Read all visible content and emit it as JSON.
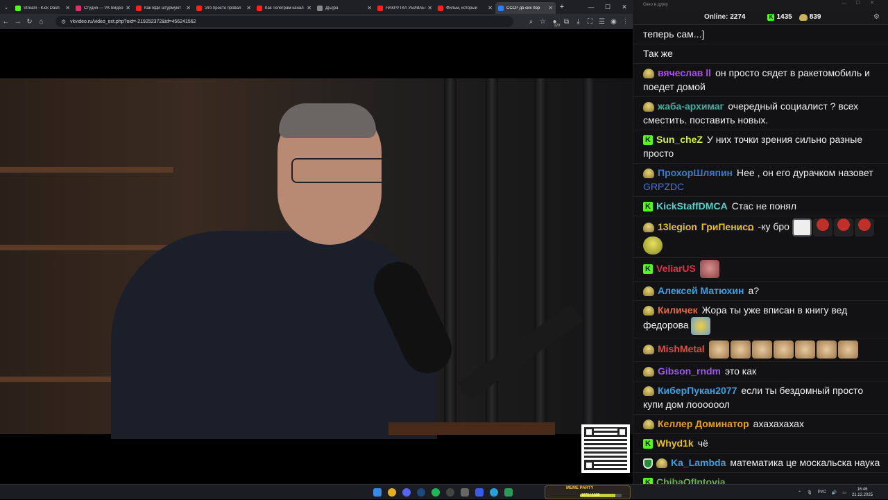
{
  "browser": {
    "tabs": [
      {
        "title": "Stream - Kick Dash",
        "color": "#53fc18",
        "active": false
      },
      {
        "title": "Студия — VK Видео",
        "color": "#e0306a",
        "active": false
      },
      {
        "title": "Как ВДВ штурмуют",
        "color": "#ff2020",
        "active": false
      },
      {
        "title": "Это просто провал",
        "color": "#ff2020",
        "active": false
      },
      {
        "title": "Как Телеграм-канал",
        "color": "#ff2020",
        "active": false
      },
      {
        "title": "Д[ы]ра",
        "color": "#888888",
        "active": false
      },
      {
        "title": "НАКРУТКА УБИВАЕТ",
        "color": "#ff2020",
        "active": false
      },
      {
        "title": "Фильм, который",
        "color": "#ff2020",
        "active": false
      },
      {
        "title": "СССР до сих пор",
        "color": "#2a7fff",
        "active": true
      }
    ],
    "url": "vkvideo.ru/video_ext.php?oid=-219252372&id=456241562",
    "extension_badge": "129"
  },
  "chat": {
    "window_title": "Окно в дурку",
    "online_label": "Online:",
    "online_count": "2274",
    "kick_count": "1435",
    "gold_count": "839",
    "messages": [
      {
        "badges": [],
        "user": "",
        "color": "#ffffff",
        "text": "теперь сам...]",
        "emotes": []
      },
      {
        "badges": [],
        "user": "",
        "color": "#ffffff",
        "text": "Так же",
        "emotes": []
      },
      {
        "badges": [
          "gold"
        ],
        "user": "вячеслав ll",
        "color": "#b04aff",
        "text": "он просто сядет в ракетомобиль и поедет домой",
        "emotes": []
      },
      {
        "badges": [
          "gold"
        ],
        "user": "жаба-архимаг",
        "color": "#3fb0a0",
        "text": "очередный социалист ? всех сместить. поставить новых.",
        "emotes": []
      },
      {
        "badges": [
          "kick"
        ],
        "user": "Sun_cheZ",
        "color": "#d4f040",
        "text": "У них точки зрения сильно разные просто",
        "emotes": []
      },
      {
        "badges": [
          "gold"
        ],
        "user": "ПрохорШляпин",
        "color": "#3a7ad0",
        "text": "Нее , он его дурачком назовет",
        "mention": "GRPZDC",
        "mention_color": "#3a7ad0",
        "emotes": []
      },
      {
        "badges": [
          "kick"
        ],
        "user": "KickStaffDMCA",
        "color": "#5ad0d0",
        "text": "Стас не понял",
        "emotes": []
      },
      {
        "badges": [
          "gold"
        ],
        "user": "13legion",
        "color": "#e8c020",
        "text": "-ку бро",
        "prefix": "ГриПенисꭥ",
        "prefix_color": "#e8c020",
        "emotes": [
          "white",
          "mush",
          "mush",
          "mush",
          "gold"
        ]
      },
      {
        "badges": [
          "kick"
        ],
        "user": "VeliarUS",
        "color": "#e0304a",
        "text": "",
        "emotes": [
          "face"
        ]
      },
      {
        "badges": [
          "gold"
        ],
        "user": "Алексей Матюхин",
        "color": "#3aa0e8",
        "text": "а?",
        "emotes": []
      },
      {
        "badges": [
          "gold"
        ],
        "user": "Киличек",
        "color": "#e86a3a",
        "text": "Жора ты уже вписан в книгу вед федорова",
        "emotes": [
          "duck"
        ]
      },
      {
        "badges": [
          "gold"
        ],
        "user": "MishMetal",
        "color": "#e84a3a",
        "text": "",
        "emotes": [
          "cat",
          "cat",
          "cat",
          "cat",
          "cat",
          "cat",
          "cat"
        ]
      },
      {
        "badges": [
          "gold"
        ],
        "user": "Gibson_rndm",
        "color": "#9a5ae8",
        "text": "это как",
        "emotes": []
      },
      {
        "badges": [
          "gold"
        ],
        "user": "КиберПукан2077",
        "color": "#3aa0e8",
        "text": "если ты бездомный просто купи дом лоооооол",
        "emotes": []
      },
      {
        "badges": [
          "gold"
        ],
        "user": "Келлер Доминатор",
        "color": "#e8a020",
        "text": "ахахахахах",
        "emotes": []
      },
      {
        "badges": [
          "kick"
        ],
        "user": "Whyd1k",
        "color": "#e8c020",
        "text": "чё",
        "emotes": []
      },
      {
        "badges": [
          "shield",
          "gold"
        ],
        "user": "Ka_Lambda",
        "color": "#3aa0e8",
        "text": "математика це москальска наука",
        "emotes": []
      },
      {
        "badges": [
          "kick"
        ],
        "user": "ChibaOfIntovia",
        "color": "#6ab04a",
        "text": "",
        "emotes": []
      }
    ]
  },
  "taskbar": {
    "game_title": "MEME PARTY",
    "game_counter": "1275 / 1500",
    "game_progress": 0.85,
    "language": "РУС",
    "time": "16:46",
    "date": "21.12.2025"
  }
}
